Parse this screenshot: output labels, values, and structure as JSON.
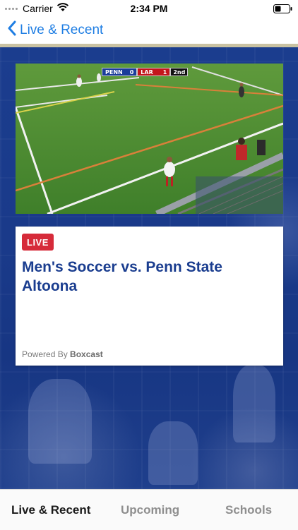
{
  "status_bar": {
    "carrier": "Carrier",
    "time": "2:34 PM",
    "icons": [
      "signal-dots-icon",
      "wifi-icon",
      "battery-icon"
    ]
  },
  "nav": {
    "back_label": "Live & Recent",
    "back_icon": "chevron-left-icon",
    "accent_color": "#1f7ee3"
  },
  "video": {
    "scoreboard": {
      "home_team": "PENN",
      "home_score": "0",
      "away_team": "LAR",
      "away_score": "1",
      "period": "2nd"
    }
  },
  "event_card": {
    "badge": "LIVE",
    "badge_color": "#d62b3a",
    "title": "Men's Soccer vs. Penn State Altoona",
    "title_color": "#1a3d8f",
    "powered_prefix": "Powered By",
    "powered_brand": "Boxcast"
  },
  "tab_bar": {
    "tabs": [
      {
        "label": "Live & Recent",
        "active": true
      },
      {
        "label": "Upcoming",
        "active": false
      },
      {
        "label": "Schools",
        "active": false
      }
    ]
  }
}
